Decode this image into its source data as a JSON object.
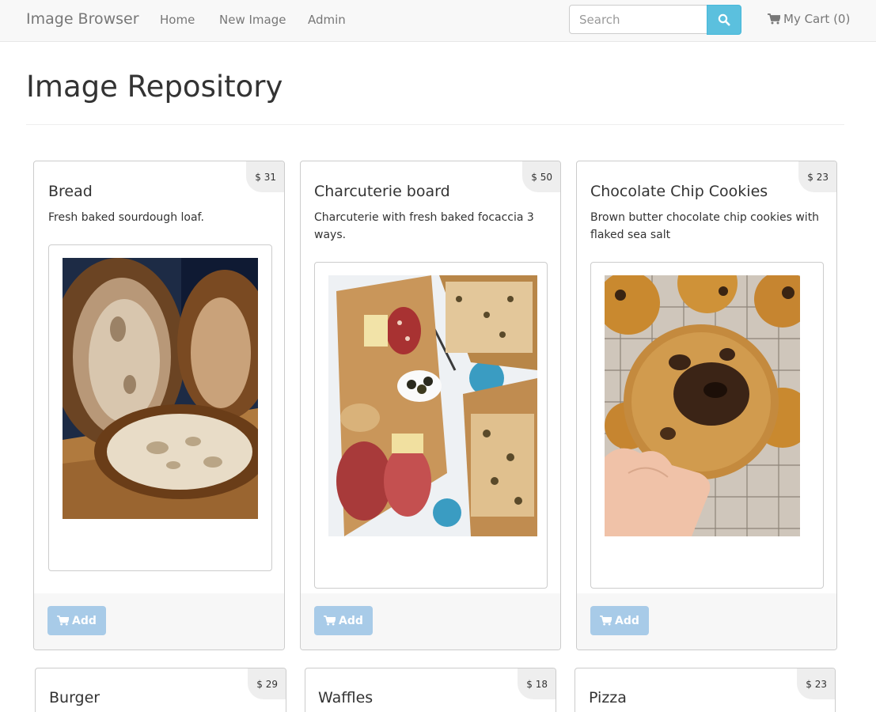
{
  "navbar": {
    "brand": "Image Browser",
    "links": [
      "Home",
      "New Image",
      "Admin"
    ],
    "search": {
      "placeholder": "Search",
      "value": ""
    },
    "cart_label": "My Cart (0)",
    "icons": {
      "search": "search-icon",
      "cart": "cart-icon"
    }
  },
  "page": {
    "title": "Image Repository"
  },
  "products": [
    {
      "title": "Bread",
      "price": "$ 31",
      "description": "Fresh baked sourdough loaf.",
      "image": "bread photo",
      "add_label": "Add"
    },
    {
      "title": "Charcuterie board",
      "price": "$ 50",
      "description": "Charcuterie with fresh baked focaccia 3 ways.",
      "image": "charcuterie board photo",
      "add_label": "Add"
    },
    {
      "title": "Chocolate Chip Cookies",
      "price": "$ 23",
      "description": "Brown butter chocolate chip cookies with flaked sea salt",
      "image": "chocolate chip cookie photo",
      "add_label": "Add"
    },
    {
      "title": "Burger",
      "price": "$ 29"
    },
    {
      "title": "Waffles",
      "price": "$ 18"
    },
    {
      "title": "Pizza",
      "price": "$ 23"
    }
  ],
  "colors": {
    "search_button": "#5bc0de",
    "add_button": "#a8cbe8",
    "navbar": "#f8f8f8"
  }
}
